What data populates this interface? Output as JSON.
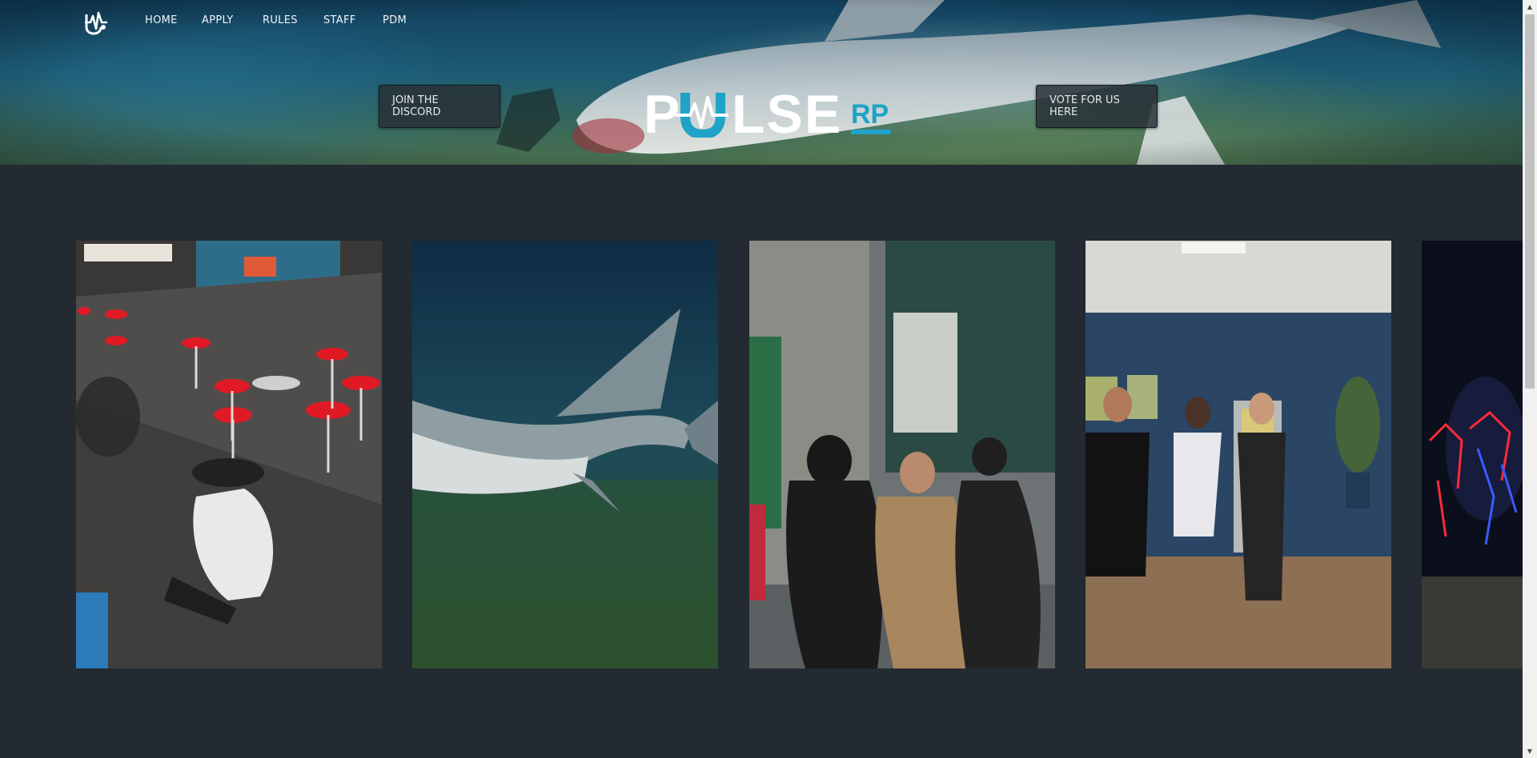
{
  "nav": {
    "logo_icon": "pulse-heartbeat-logo-icon",
    "links": [
      "HOME",
      "APPLY",
      "RULES",
      "STAFF",
      "PDM"
    ]
  },
  "hero": {
    "left_button": "JOIN THE DISCORD",
    "right_button": "VOTE FOR US HERE",
    "brand": {
      "name": "PULSE",
      "suffix": "RP",
      "accent": "#1fa3c7"
    }
  },
  "gallery": {
    "images": [
      "cafe-interior-photo",
      "shark-underwater-photo",
      "crew-group-photo",
      "clinic-waiting-room-photo",
      "neon-figures-photo"
    ]
  },
  "colors": {
    "page_bg": "#232a31",
    "accent": "#1fa3c7"
  }
}
